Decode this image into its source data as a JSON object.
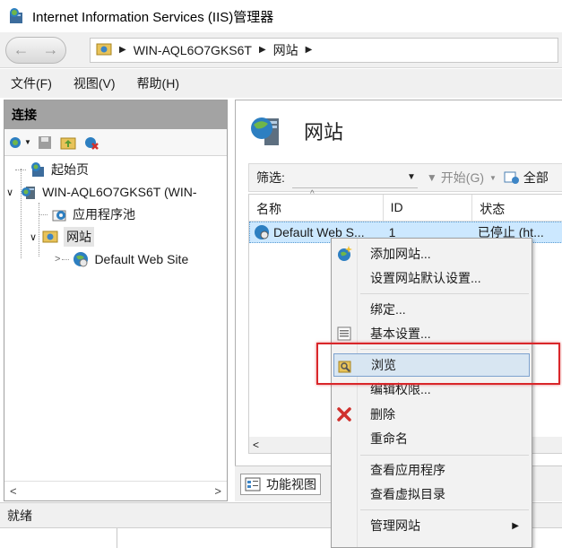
{
  "window": {
    "title": "Internet Information Services (IIS)管理器"
  },
  "address": {
    "crumbs": [
      "WIN-AQL6O7GKS6T",
      "网站"
    ]
  },
  "menubar": {
    "items": [
      "文件(F)",
      "视图(V)",
      "帮助(H)"
    ]
  },
  "connections": {
    "header": "连接",
    "tree": {
      "start_page": "起始页",
      "server": "WIN-AQL6O7GKS6T (WIN-",
      "app_pools": "应用程序池",
      "sites": "网站",
      "default_site": "Default Web Site"
    }
  },
  "main": {
    "title": "网站",
    "filter": {
      "label": "筛选:",
      "go": "开始(G)",
      "all": "全部"
    },
    "columns": [
      "名称",
      "ID",
      "状态"
    ],
    "rows": [
      {
        "name": "Default Web S...",
        "id": "1",
        "status": "已停止 (ht..."
      }
    ]
  },
  "bottom_tab": {
    "features_view": "功能视图"
  },
  "status": {
    "text": "就绪"
  },
  "context_menu": {
    "items": [
      "添加网站...",
      "设置网站默认设置...",
      "绑定...",
      "基本设置...",
      "浏览",
      "编辑权限...",
      "删除",
      "重命名",
      "查看应用程序",
      "查看虚拟目录",
      "管理网站"
    ],
    "highlighted": "浏览"
  },
  "colors": {
    "highlight_box": "#d9262a",
    "selection": "#cce8ff",
    "pane_header": "#a3a3a3"
  }
}
